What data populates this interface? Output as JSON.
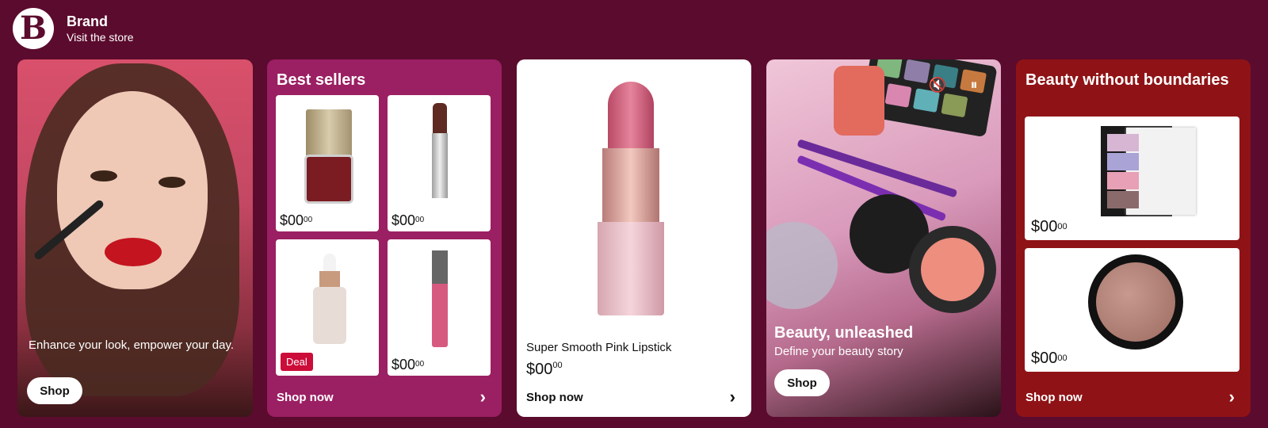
{
  "brand": {
    "logo_letter": "B",
    "name": "Brand",
    "subtitle": "Visit the store"
  },
  "card1": {
    "tagline": "Enhance your look, empower your day.",
    "button": "Shop"
  },
  "card2": {
    "title": "Best sellers",
    "tiles": [
      {
        "product": "nail-polish",
        "price_main": "$00",
        "price_cents": "00"
      },
      {
        "product": "lipstick",
        "price_main": "$00",
        "price_cents": "00"
      },
      {
        "product": "serum-bottle",
        "badge": "Deal"
      },
      {
        "product": "lip-gloss",
        "price_main": "$00",
        "price_cents": "00"
      }
    ],
    "link": "Shop now",
    "chevron": "›"
  },
  "card3": {
    "product_name": "Super Smooth Pink Lipstick",
    "price_main": "$00",
    "price_cents": "00",
    "link": "Shop now",
    "chevron": "›"
  },
  "card4": {
    "headline": "Beauty, unleashed",
    "subline": "Define your beauty story",
    "button": "Shop",
    "mute_icon": "🔇",
    "pause_icon": "⏸"
  },
  "card5": {
    "title": "Beauty without boundaries",
    "tiles": [
      {
        "product": "eyeshadow-palette",
        "price_main": "$00",
        "price_cents": "00"
      },
      {
        "product": "eyeshadow-pan",
        "price_main": "$00",
        "price_cents": "00"
      }
    ],
    "link": "Shop now",
    "chevron": "›"
  }
}
